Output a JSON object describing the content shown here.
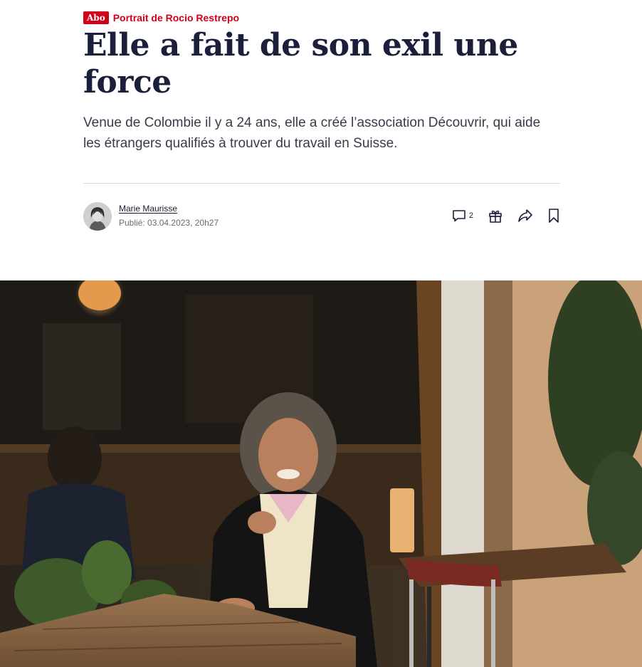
{
  "article": {
    "badge": "Abo",
    "kicker": "Portrait de Rocio Restrepo",
    "headline": "Elle a fait de son exil une force",
    "lead": "Venue de Colombie il y a 24 ans, elle a créé l’association Découvrir, qui aide les étrangers qualifiés à trouver du travail en Suisse.",
    "author": "Marie Maurisse",
    "published": "Publié: 03.04.2023, 20h27",
    "comment_count": "2"
  },
  "icons": [
    "comment-icon",
    "gift-icon",
    "share-icon",
    "bookmark-icon"
  ],
  "colors": {
    "accent": "#d0021b",
    "headline": "#1b1f3b",
    "text": "#3a3a4a",
    "muted": "#6b6b6b",
    "divider": "#d7d7d7"
  }
}
